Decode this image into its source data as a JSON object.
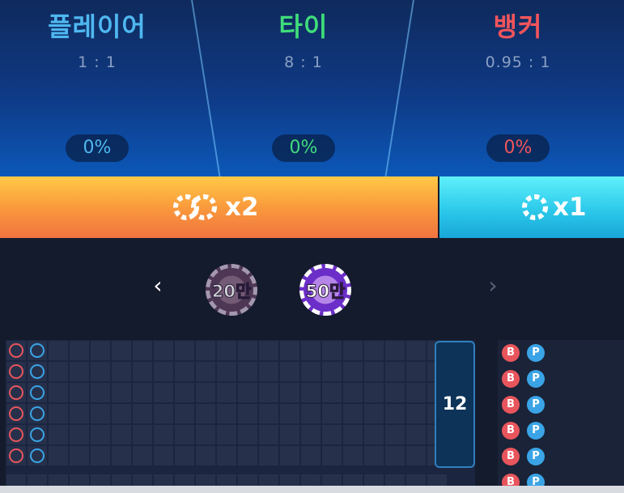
{
  "bets": [
    {
      "id": "player",
      "title": "플레이어",
      "odds": "1 : 1",
      "percent": "0%",
      "color": "#4fb7f0"
    },
    {
      "id": "tie",
      "title": "타이",
      "odds": "8 : 1",
      "percent": "0%",
      "color": "#3fdc7a"
    },
    {
      "id": "banker",
      "title": "뱅커",
      "odds": "0.95 : 1",
      "percent": "0%",
      "color": "#f2555b"
    }
  ],
  "multipliers": {
    "left_label": "x2",
    "right_label": "x1",
    "left_color": "#f58a3c",
    "right_color": "#2cc9ea"
  },
  "chips": {
    "prev_icon": "‹",
    "next_icon": "›",
    "items": [
      {
        "label": "20만",
        "state": "dimmed"
      },
      {
        "label": "50만",
        "state": "selected"
      }
    ]
  },
  "road": {
    "round_count": "12",
    "banker_color": "#e8555c",
    "player_color": "#3aa4e6"
  },
  "predict": {
    "banker_label": "B",
    "player_label": "P"
  }
}
